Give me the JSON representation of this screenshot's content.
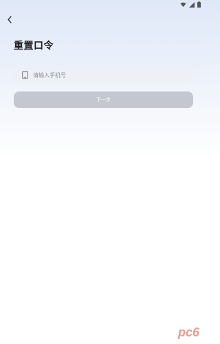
{
  "header": {
    "back_icon": "chevron-left-icon"
  },
  "status_bar": {
    "icons": [
      "wifi-icon",
      "signal-icon",
      "battery-icon"
    ]
  },
  "page": {
    "title": "重置口令"
  },
  "form": {
    "phone": {
      "icon": "phone-icon",
      "placeholder": "请输入手机号",
      "value": ""
    },
    "next_label": "下一步"
  },
  "watermark": {
    "text": "pc6"
  },
  "colors": {
    "button_disabled": "#c3c7d0",
    "field_bg": "#edf1f7",
    "title": "#1f1f1f",
    "placeholder": "#8a9099",
    "watermark": "#d94a2c"
  }
}
